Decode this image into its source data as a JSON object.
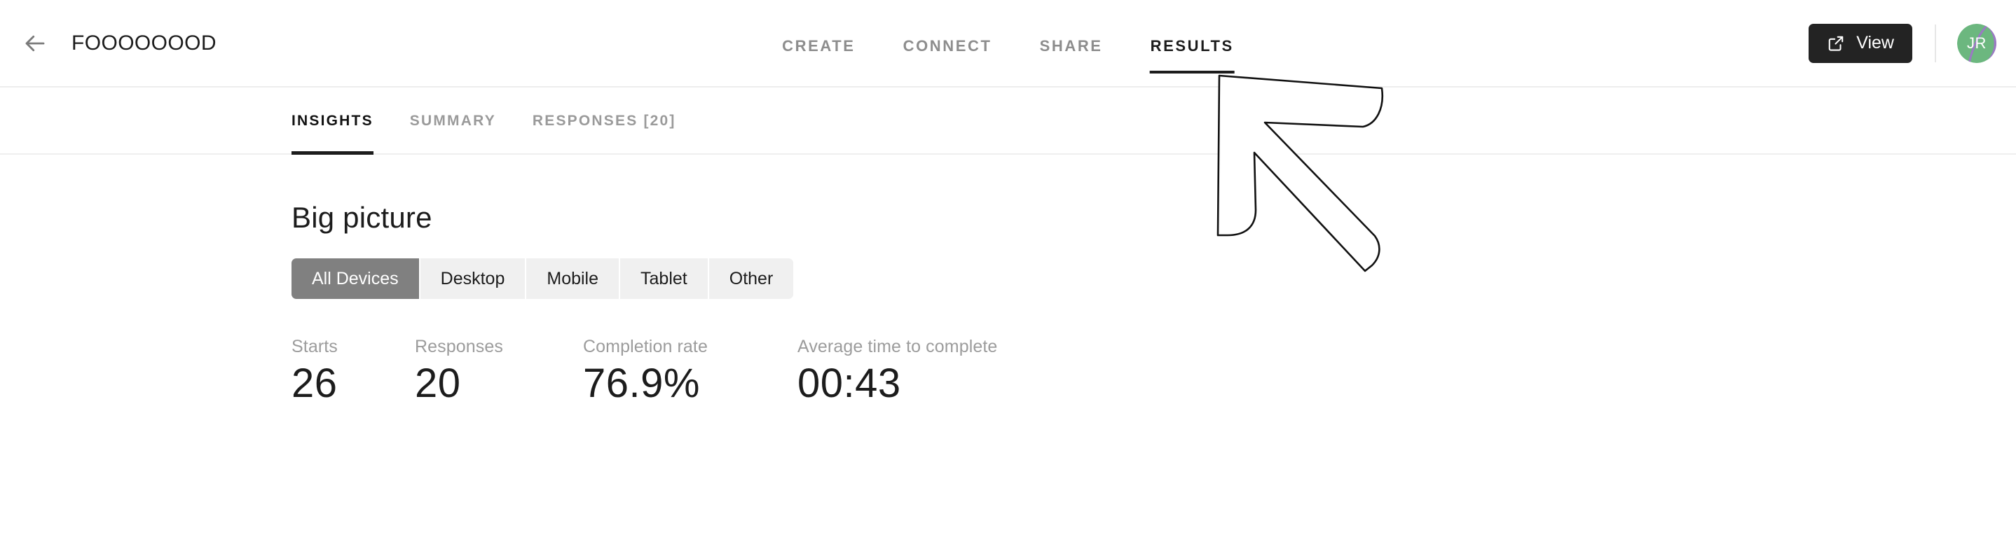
{
  "header": {
    "back_icon": "arrow-left-icon",
    "title": "FOOOOOOOD",
    "nav_tabs": [
      {
        "label": "CREATE",
        "active": false
      },
      {
        "label": "CONNECT",
        "active": false
      },
      {
        "label": "SHARE",
        "active": false
      },
      {
        "label": "RESULTS",
        "active": true
      }
    ],
    "view_button": {
      "label": "View",
      "icon": "external-link-icon",
      "background": "#232323",
      "text_color": "#ffffff"
    },
    "avatar": {
      "initials": "JR",
      "color_primary": "#6cb77f",
      "color_secondary": "#9b79c4"
    }
  },
  "sub_tabs": [
    {
      "label": "INSIGHTS",
      "active": true
    },
    {
      "label": "SUMMARY",
      "active": false
    },
    {
      "label": "RESPONSES [20]",
      "active": false
    }
  ],
  "main": {
    "section_title": "Big picture",
    "device_filter": {
      "options": [
        {
          "label": "All Devices",
          "selected": true
        },
        {
          "label": "Desktop",
          "selected": false
        },
        {
          "label": "Mobile",
          "selected": false
        },
        {
          "label": "Tablet",
          "selected": false
        },
        {
          "label": "Other",
          "selected": false
        }
      ],
      "selected_color": "#808080",
      "unselected_color": "#f0f0f0"
    },
    "stats": [
      {
        "label": "Starts",
        "value": "26"
      },
      {
        "label": "Responses",
        "value": "20"
      },
      {
        "label": "Completion rate",
        "value": "76.9%"
      },
      {
        "label": "Average time to complete",
        "value": "00:43"
      }
    ]
  },
  "annotation": {
    "type": "arrow",
    "direction": "up-left",
    "stroke": "#111111",
    "fill": "#ffffff"
  }
}
